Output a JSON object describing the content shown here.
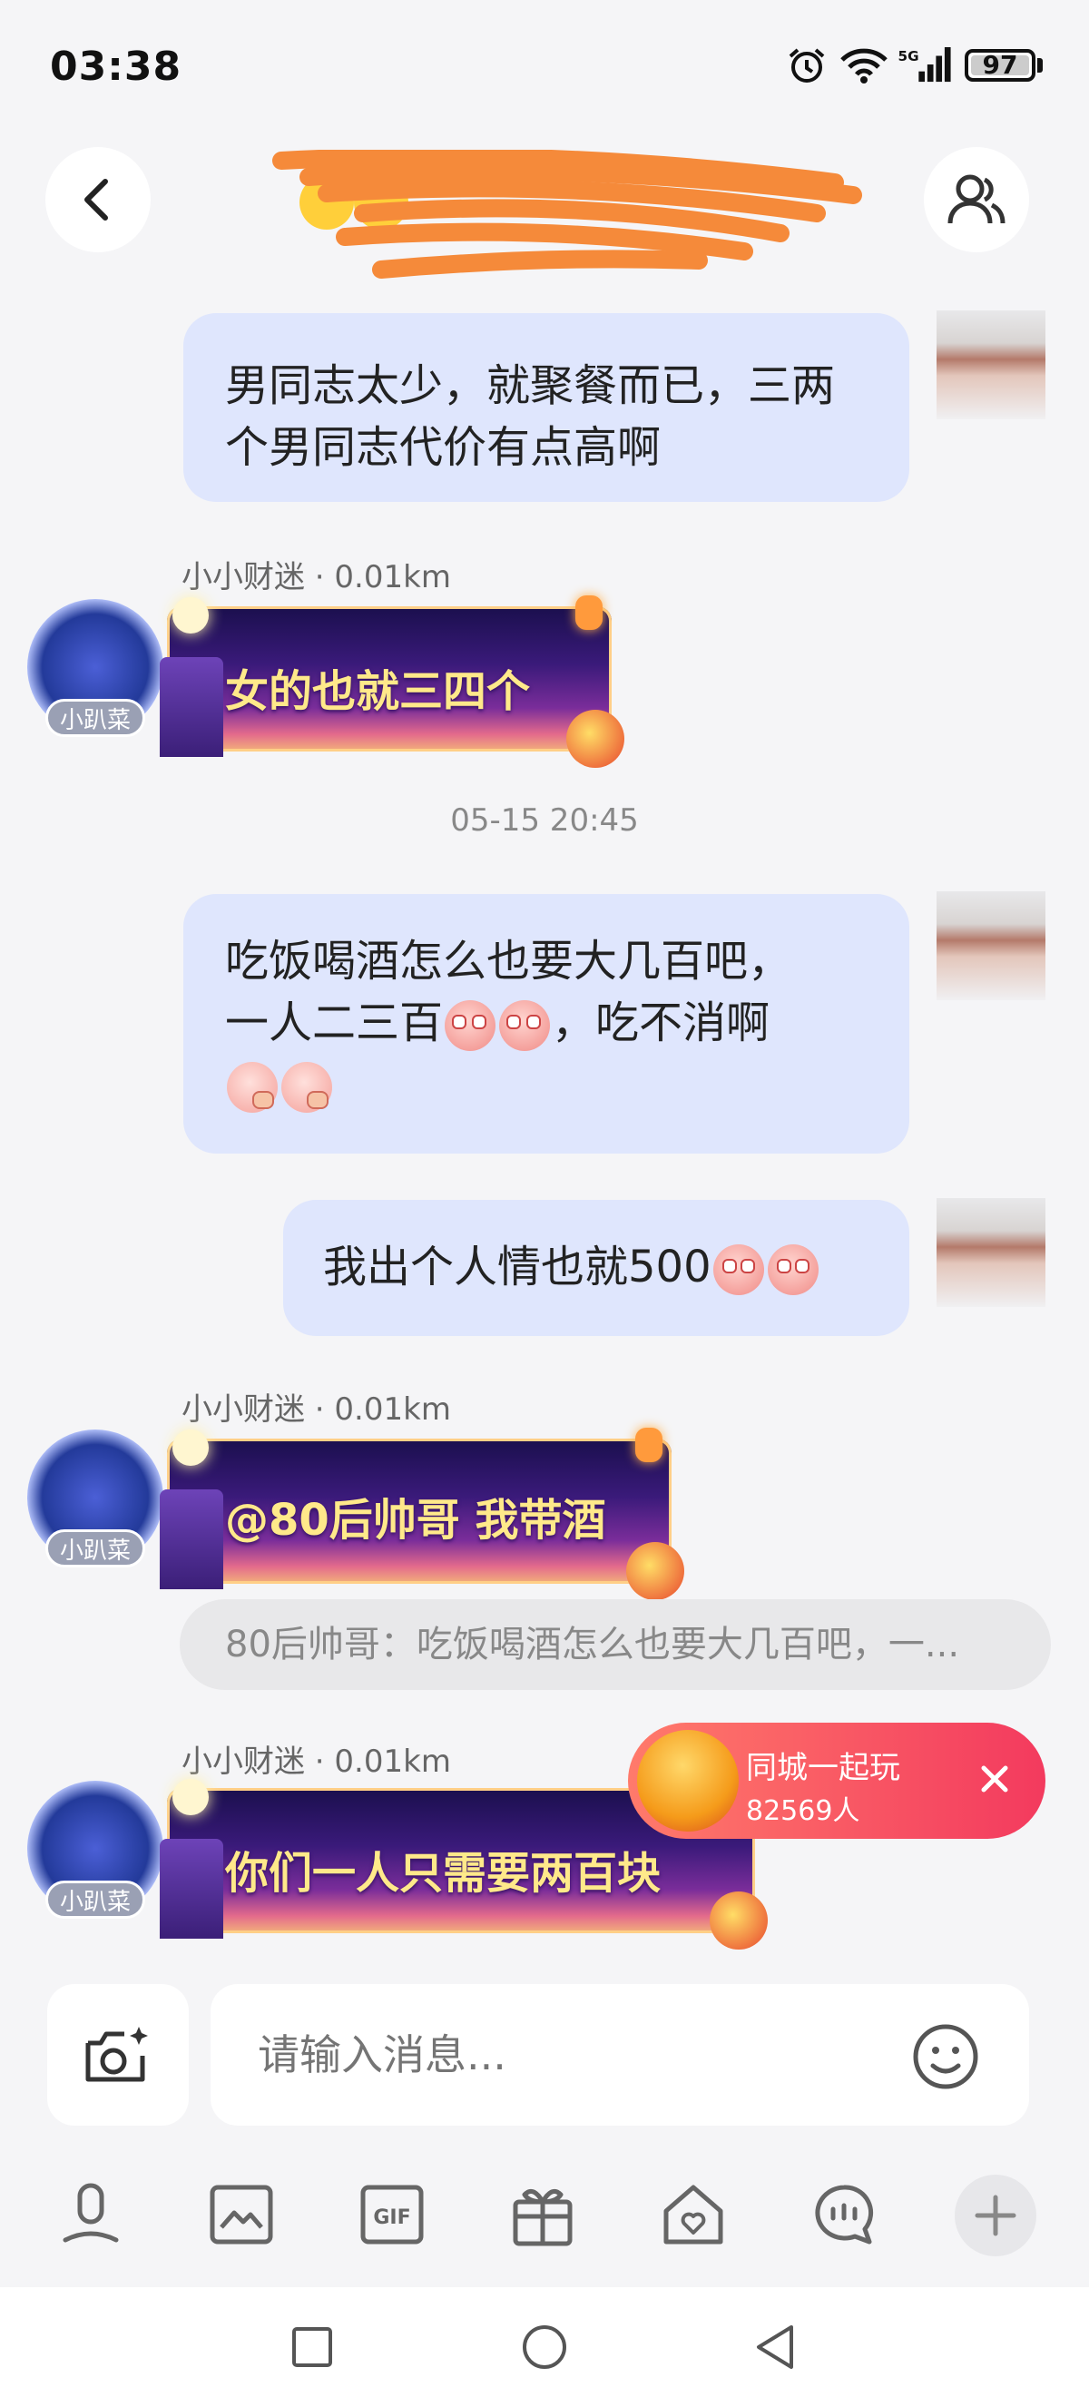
{
  "status_bar": {
    "time": "03:38",
    "battery": "97"
  },
  "header": {
    "title_emojis": [
      "😍",
      "😆"
    ]
  },
  "messages": [
    {
      "type": "outgoing",
      "text": "男同志太少，就聚餐而已，三两个男同志代价有点高啊"
    },
    {
      "type": "incoming",
      "sender": "小小财迷 · 0.01km",
      "badge": "小趴菜",
      "text": "女的也就三四个"
    },
    {
      "type": "timestamp",
      "text": "05-15 20:45"
    },
    {
      "type": "outgoing",
      "line1": "吃饭喝酒怎么也要大几百吧，",
      "line2_a": "一人二三百",
      "line2_b": "，吃不消啊"
    },
    {
      "type": "outgoing",
      "text": "我出个人情也就500"
    },
    {
      "type": "incoming",
      "sender": "小小财迷 · 0.01km",
      "badge": "小趴菜",
      "text": "@80后帅哥 我带酒",
      "quote": "80后帅哥：吃饭喝酒怎么也要大几百吧，一..."
    },
    {
      "type": "incoming",
      "sender": "小小财迷 · 0.01km",
      "badge": "小趴菜",
      "text": "你们一人只需要两百块"
    }
  ],
  "promo": {
    "title": "同城一起玩",
    "count": "82569人"
  },
  "input": {
    "placeholder": "请输入消息..."
  },
  "toolbar": {
    "items": [
      "voice-icon",
      "image-icon",
      "gif-icon",
      "gift-icon",
      "home-heart-icon",
      "chat-icon",
      "plus-icon"
    ],
    "gif_label": "GIF"
  },
  "colors": {
    "outgoing_bubble": "#dfe6fd",
    "promo": "#f33a5e",
    "background": "#f5f5f7"
  }
}
